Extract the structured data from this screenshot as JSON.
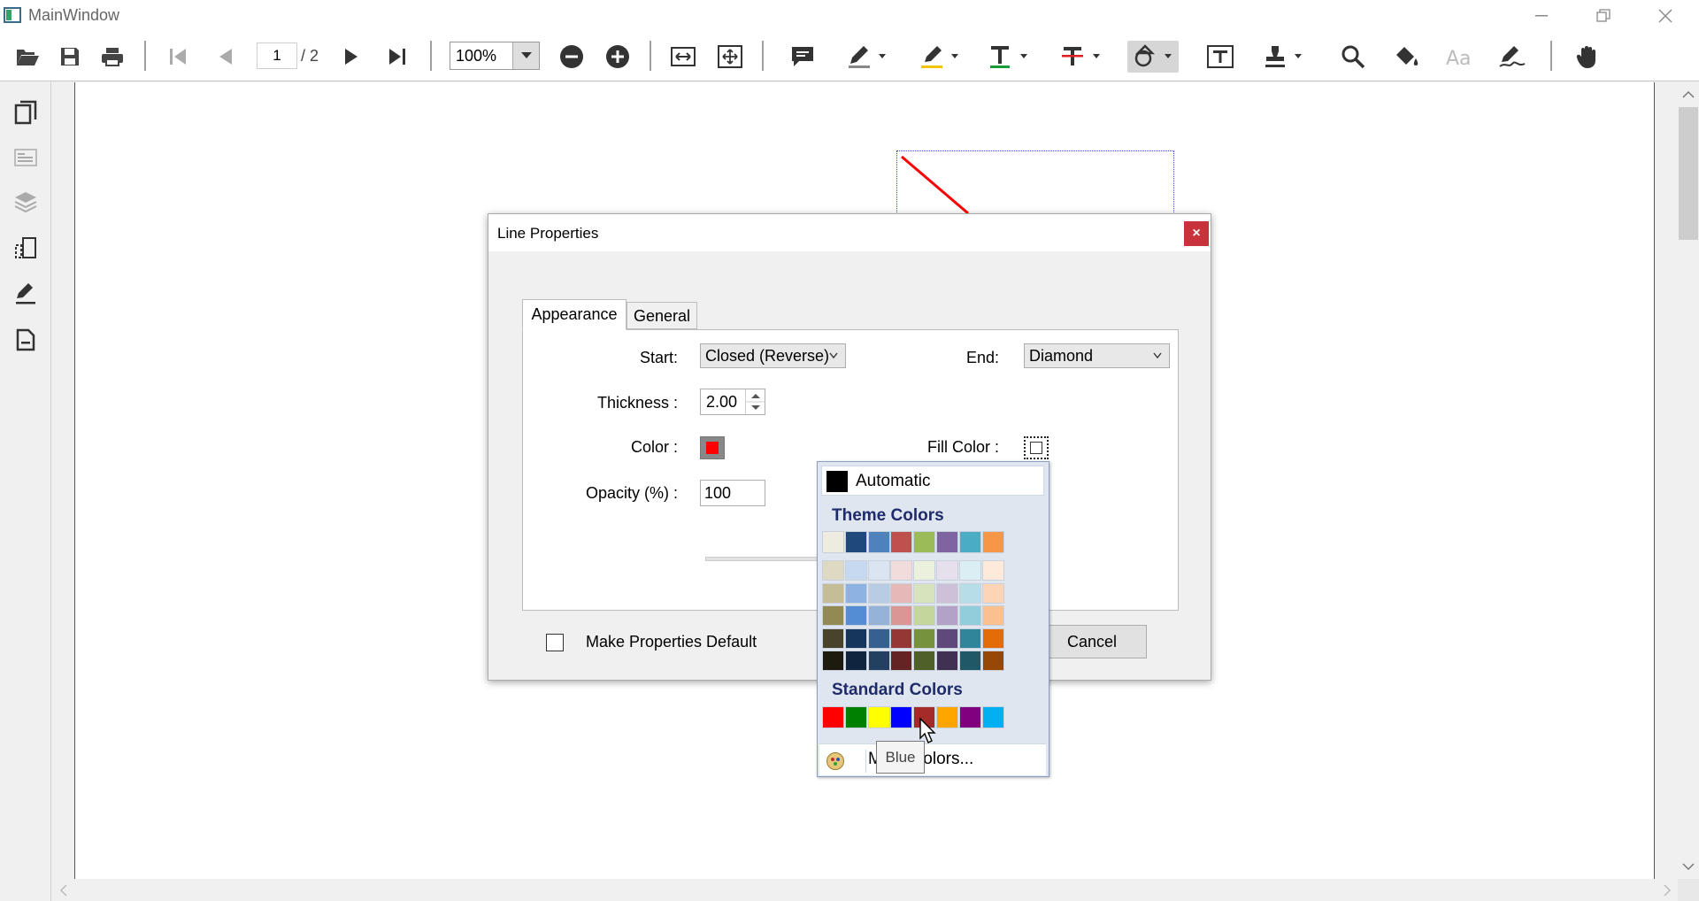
{
  "window": {
    "title": "MainWindow"
  },
  "toolbar": {
    "page_current": "1",
    "page_total": "/ 2",
    "zoom": "100%"
  },
  "dialog": {
    "title": "Line Properties",
    "close_label": "×",
    "tabs": [
      "Appearance",
      "General"
    ],
    "start_label": "Start:",
    "start_value": "Closed (Reverse)",
    "end_label": "End:",
    "end_value": "Diamond",
    "thickness_label": "Thickness :",
    "thickness_value": "2.00",
    "color_label": "Color :",
    "fill_color_label": "Fill Color :",
    "opacity_label": "Opacity (%) :",
    "opacity_value": "100",
    "make_default_label": "Make Properties Default",
    "cancel_label": "Cancel"
  },
  "color_popup": {
    "automatic_label": "Automatic",
    "theme_heading": "Theme Colors",
    "standard_heading": "Standard Colors",
    "more_colors_label": "More Colors...",
    "tooltip": "Blue",
    "theme_base": [
      "#eeece1",
      "#1f497d",
      "#4f81bd",
      "#c0504d",
      "#9bbb59",
      "#8064a2",
      "#4bacc6",
      "#f79646"
    ],
    "theme_shades": [
      [
        "#ddd9c3",
        "#c6d9f0",
        "#dbe5f1",
        "#f2dcdb",
        "#ebf1dd",
        "#e5e0ec",
        "#dbeef3",
        "#fdeada"
      ],
      [
        "#c4bd97",
        "#8db3e2",
        "#b8cce4",
        "#e5b9b7",
        "#d7e3bc",
        "#ccc1d9",
        "#b7dde8",
        "#fbd5b5"
      ],
      [
        "#938953",
        "#548dd4",
        "#95b3d7",
        "#d99694",
        "#c3d69b",
        "#b2a2c7",
        "#92cddc",
        "#fac08f"
      ],
      [
        "#494429",
        "#17365d",
        "#366092",
        "#953734",
        "#76923c",
        "#5f497a",
        "#31859b",
        "#e36c09"
      ],
      [
        "#1d1b10",
        "#0f243e",
        "#244061",
        "#632423",
        "#4f6128",
        "#3f3151",
        "#205867",
        "#974806"
      ]
    ],
    "standard": [
      "#ff0000",
      "#008000",
      "#ffff00",
      "#0000ff",
      "#a52a2a",
      "#ffa500",
      "#800080",
      "#00b0f0"
    ]
  },
  "colors": {
    "line_annotation": "#ff0000",
    "close_button": "#c8323a"
  }
}
